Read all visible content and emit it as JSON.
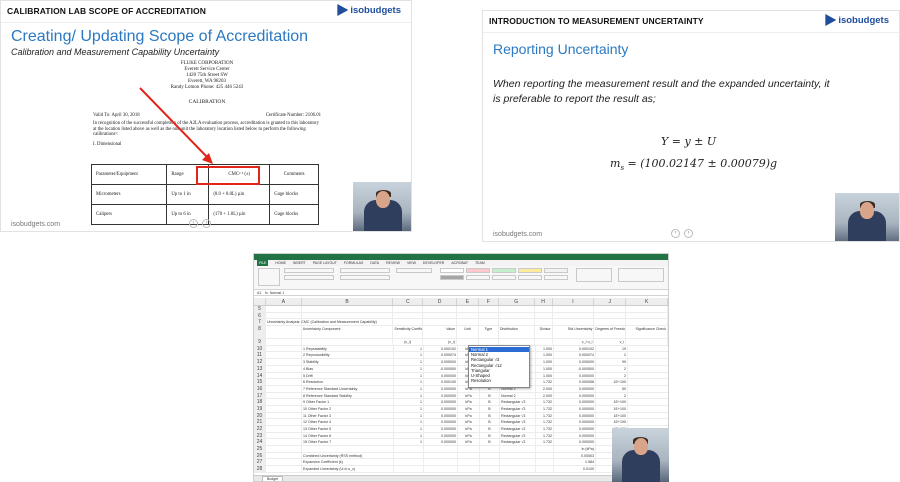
{
  "slide1": {
    "header": "CALIBRATION LAB SCOPE OF ACCREDITATION",
    "logo": "isobudgets",
    "title": "Creating/ Updating Scope of Accreditation",
    "subtitle": "Calibration and Measurement Capability Uncertainty",
    "footer": "isobudgets.com",
    "certificate": {
      "company": "FLUKE CORPORATION",
      "line2": "Everett Service Center",
      "line3": "1420 75th Street SW",
      "line4": "Everett, WA 98203",
      "line5": "Randy Lomon        Phone: 425 446 5243",
      "section": "CALIBRATION",
      "valid": "Valid To:  April 30, 2018",
      "cert_no": "Certificate Number: 2106.01",
      "paragraph": "In recognition of the successful completion of the A2LA evaluation process, accreditation is granted to this laboratory at the location listed above as well as the one unit the laboratory location listed below to perform the following calibrations¹:",
      "dimensional": "I. Dimensional",
      "table_headers": [
        "Parameter/Equipment",
        "Range",
        "CMC² ³ (±)",
        "Comments"
      ],
      "rows": [
        [
          "Micrometers",
          "Up to 1 in",
          "(8.0 + 8.0L) µin",
          "Gage blocks"
        ],
        [
          "Calipers",
          "Up to 6 in",
          "(170 + 1.8L) µin",
          "Gage blocks"
        ]
      ]
    }
  },
  "slide2": {
    "header": "INTRODUCTION TO MEASUREMENT UNCERTAINTY",
    "logo": "isobudgets",
    "title": "Reporting Uncertainty",
    "paragraph": "When reporting the measurement result and the expanded uncertainty, it is preferable to report the result as;",
    "eq1": "Y = y ± U",
    "eq2_lhs": "m",
    "eq2_sub": "s",
    "eq2_rhs": " = (100.02147 ± 0.00079)g",
    "footer": "isobudgets.com"
  },
  "excel": {
    "tabs": [
      "FILE",
      "HOME",
      "INSERT",
      "PAGE LAYOUT",
      "FORMULAS",
      "DATA",
      "REVIEW",
      "VIEW",
      "DEVELOPER",
      "ACROBAT",
      "TEAM"
    ],
    "cell_ref": "A1",
    "formula": "Normal 1",
    "sheet_tab": "Budget",
    "columns": [
      "A",
      "B",
      "C",
      "D",
      "E",
      "F",
      "G",
      "H",
      "I",
      "J",
      "K"
    ],
    "title_row": "Uncertainty Analysis: CMC (Calibration and Measurement Capability)",
    "header": [
      "",
      "Uncertainty Component",
      "Sensitivity Coefficient",
      "Value",
      "Unit",
      "Type",
      "Distribution",
      "Divisor",
      "Std Uncertainty",
      "Degrees of Freedom",
      "Significance Check"
    ],
    "header2": [
      "",
      "",
      "(c_i)",
      "(x_i)",
      "",
      "",
      "",
      "",
      "c_i·u_i",
      "v_i",
      ""
    ],
    "rows": [
      [
        "10",
        "1 Repeatability",
        "1",
        "0.000102",
        "kPa",
        "A",
        "Normal 1",
        "1.000",
        "0.000102",
        "19",
        "0.3%"
      ],
      [
        "11",
        "2 Reproducibility",
        "1",
        "0.000074",
        "kPa",
        "A",
        "Normal 1",
        "1.000",
        "0.000074",
        "2",
        "0.1%"
      ],
      [
        "12",
        "3 Stability",
        "1",
        "0.005000",
        "kPa",
        "A",
        "Normal 1",
        "1.000",
        "0.005000",
        "99",
        "98.8%"
      ],
      [
        "13",
        "4 Bias",
        "1",
        "-0.000500",
        "kPa",
        "A",
        "Normal 1",
        "1.000",
        "-0.000500",
        "2",
        "1.0%"
      ],
      [
        "14",
        "5 Drift",
        "1",
        "0.000000",
        "kPa",
        "A",
        "Normal 1",
        "1.000",
        "0.000000",
        "2",
        "0.0%"
      ],
      [
        "15",
        "6 Resolution",
        "1",
        "0.000100",
        "kPa",
        "B",
        "Rectangular √3",
        "1.732",
        "0.000058",
        "1E+100",
        "0.1%"
      ],
      [
        "16",
        "7 Reference Standard Uncertainty",
        "1",
        "0.000000",
        "kPa",
        "B",
        "Normal 2",
        "2.000",
        "0.000000",
        "50",
        "0.0%"
      ],
      [
        "17",
        "8 Reference Standard Stability",
        "1",
        "0.000000",
        "kPa",
        "B",
        "Normal 2",
        "2.000",
        "0.000000",
        "2",
        "0.0%"
      ],
      [
        "18",
        "9 Other Factor 1",
        "1",
        "0.000000",
        "kPa",
        "B",
        "Rectangular √3",
        "1.732",
        "0.000000",
        "1E+100",
        "0.0%"
      ],
      [
        "19",
        "10 Other Factor 2",
        "1",
        "0.000000",
        "kPa",
        "B",
        "Rectangular √3",
        "1.732",
        "0.000000",
        "1E+100",
        "0.0%"
      ],
      [
        "20",
        "11 Other Factor 3",
        "1",
        "0.000000",
        "kPa",
        "B",
        "Rectangular √3",
        "1.732",
        "0.000000",
        "1E+100",
        "0.0%"
      ],
      [
        "21",
        "12 Other Factor 4",
        "1",
        "0.000000",
        "kPa",
        "B",
        "Rectangular √3",
        "1.732",
        "0.000000",
        "1E+100",
        "0.0%"
      ],
      [
        "22",
        "13 Other Factor 5",
        "1",
        "0.000000",
        "kPa",
        "B",
        "Rectangular √3",
        "1.732",
        "0.000000",
        "1E+100",
        "0.0%"
      ],
      [
        "23",
        "14 Other Factor 6",
        "1",
        "0.000000",
        "kPa",
        "B",
        "Rectangular √3",
        "1.732",
        "0.000000",
        "1E+100",
        "0.0%"
      ],
      [
        "24",
        "15 Other Factor 7",
        "1",
        "0.000000",
        "kPa",
        "B",
        "Rectangular √3",
        "1.732",
        "0.000000",
        "1E+100",
        "0.0%"
      ]
    ],
    "summary": [
      [
        "25",
        "",
        "",
        "",
        "",
        "",
        "",
        "",
        "in (kPa)",
        "Veff",
        ""
      ],
      [
        "26",
        "Combined Uncertainty (RSS method)",
        "",
        "",
        "",
        "",
        "",
        "",
        "0.00503",
        "99.5",
        ""
      ],
      [
        "27",
        "Expansion Coefficient (k)",
        "",
        "",
        "",
        "",
        "",
        "",
        "1.984",
        "",
        ""
      ],
      [
        "28",
        "Expanded Uncertainty (U=k·u_c)",
        "",
        "",
        "",
        "",
        "",
        "",
        "0.0100",
        "",
        ""
      ]
    ],
    "dropdown": [
      "Normal 1",
      "Normal 2",
      "Rectangular √3",
      "Rectangular √12",
      "Triangular",
      "U-Shaped",
      "Resolution"
    ],
    "dropdown_selected": 0
  },
  "colors": {
    "accent": "#2b79c2",
    "red": "#e1251b",
    "excel_green": "#217346"
  }
}
